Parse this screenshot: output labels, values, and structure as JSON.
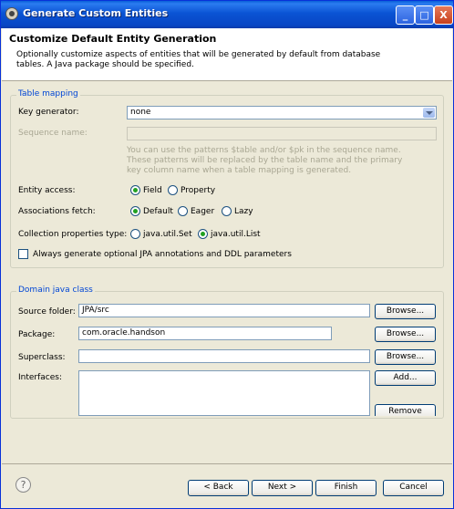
{
  "window": {
    "title": "Generate Custom Entities",
    "controls": [
      "_",
      "□",
      "X"
    ]
  },
  "header": {
    "title": "Customize Default Entity Generation",
    "description": "Optionally customize aspects of entities that will be generated by default from database tables. A Java package should be specified."
  },
  "table_mapping": {
    "legend": "Table mapping",
    "key_generator_label": "Key generator:",
    "key_generator_value": "none",
    "sequence_name_label": "Sequence name:",
    "sequence_name_value": "",
    "sequence_hint": "You can use the patterns $table and/or $pk in the sequence name. These patterns will be replaced by the table name and the primary key column name when a table mapping is generated.",
    "entity_access_label": "Entity access:",
    "entity_access_options": [
      "Field",
      "Property"
    ],
    "entity_access_selected": "Field",
    "associations_fetch_label": "Associations fetch:",
    "associations_fetch_options": [
      "Default",
      "Eager",
      "Lazy"
    ],
    "associations_fetch_selected": "Default",
    "collection_type_label": "Collection properties type:",
    "collection_type_options": [
      "java.util.Set",
      "java.util.List"
    ],
    "collection_type_selected": "java.util.List",
    "always_generate_label": "Always generate optional JPA annotations and DDL parameters",
    "always_generate_checked": false
  },
  "domain_java_class": {
    "legend": "Domain java class",
    "source_folder_label": "Source folder:",
    "source_folder_value": "JPA/src",
    "package_label": "Package:",
    "package_value": "com.oracle.handson",
    "superclass_label": "Superclass:",
    "superclass_value": "",
    "interfaces_label": "Interfaces:",
    "browse_label": "Browse...",
    "add_label": "Add...",
    "remove_label": "Remove"
  },
  "footer": {
    "help_icon": "?",
    "back_label": "< Back",
    "next_label": "Next >",
    "finish_label": "Finish",
    "cancel_label": "Cancel"
  }
}
